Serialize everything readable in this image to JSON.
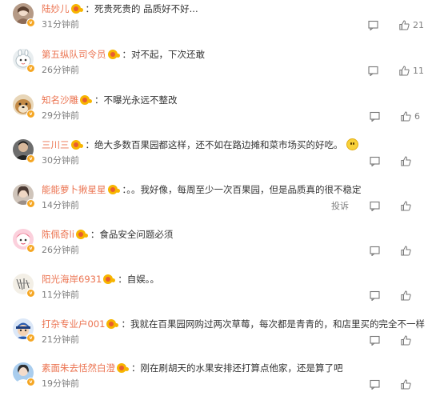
{
  "comments": [
    {
      "name": "陆妙儿",
      "text": "死贵死贵的 品质好不好...",
      "time": "31分钟前",
      "likes": "21",
      "avatar_color": "#b59a86"
    },
    {
      "name": "第五纵队司令员",
      "text": "对不起，下次还敢",
      "time": "26分钟前",
      "likes": "11",
      "avatar_color": "#cfd8dc"
    },
    {
      "name": "知名沙雕",
      "text": "不曝光永远不整改",
      "time": "29分钟前",
      "likes": "6",
      "avatar_color": "#c38a46"
    },
    {
      "name": "三川三",
      "text": "绝大多数百果园都这样，还不如在路边摊和菜市场买的好吃。",
      "time": "30分钟前",
      "likes": "",
      "avatar_color": "#4a4a4a"
    },
    {
      "name": "能能萝卜揪星星",
      "text": "。。我好像，每周至少一次百果园，但是品质真的很不稳定",
      "time": "14分钟前",
      "likes": "",
      "report": "投诉",
      "avatar_color": "#b9a89a"
    },
    {
      "name": "陈佩奇li",
      "text": "食品安全问题必须",
      "time": "26分钟前",
      "likes": "",
      "avatar_color": "#e46a8a"
    },
    {
      "name": "阳光海岸6931",
      "text": "自娱。。",
      "time": "11分钟前",
      "likes": "",
      "avatar_color": "#e8e3d8"
    },
    {
      "name": "打杂专业户001",
      "text": "我就在百果园网购过两次草莓，每次都是青青的，和店里买的完全不一样",
      "time": "21分钟前",
      "likes": "",
      "avatar_color": "#3b6fc0"
    },
    {
      "name": "素面朱去恬然白澄",
      "text": "刚在刷胡天的水果安排还打算点他家，还是算了吧",
      "time": "19分钟前",
      "likes": "",
      "avatar_color": "#6aa6d8"
    }
  ],
  "icons": {
    "reply": "comment-reply-icon",
    "like": "thumbs-up-icon",
    "verified": "verified-badge-icon",
    "fan": "fan-badge-icon"
  },
  "colors": {
    "username": "#eb7350",
    "meta": "#808080",
    "text": "#333333"
  }
}
